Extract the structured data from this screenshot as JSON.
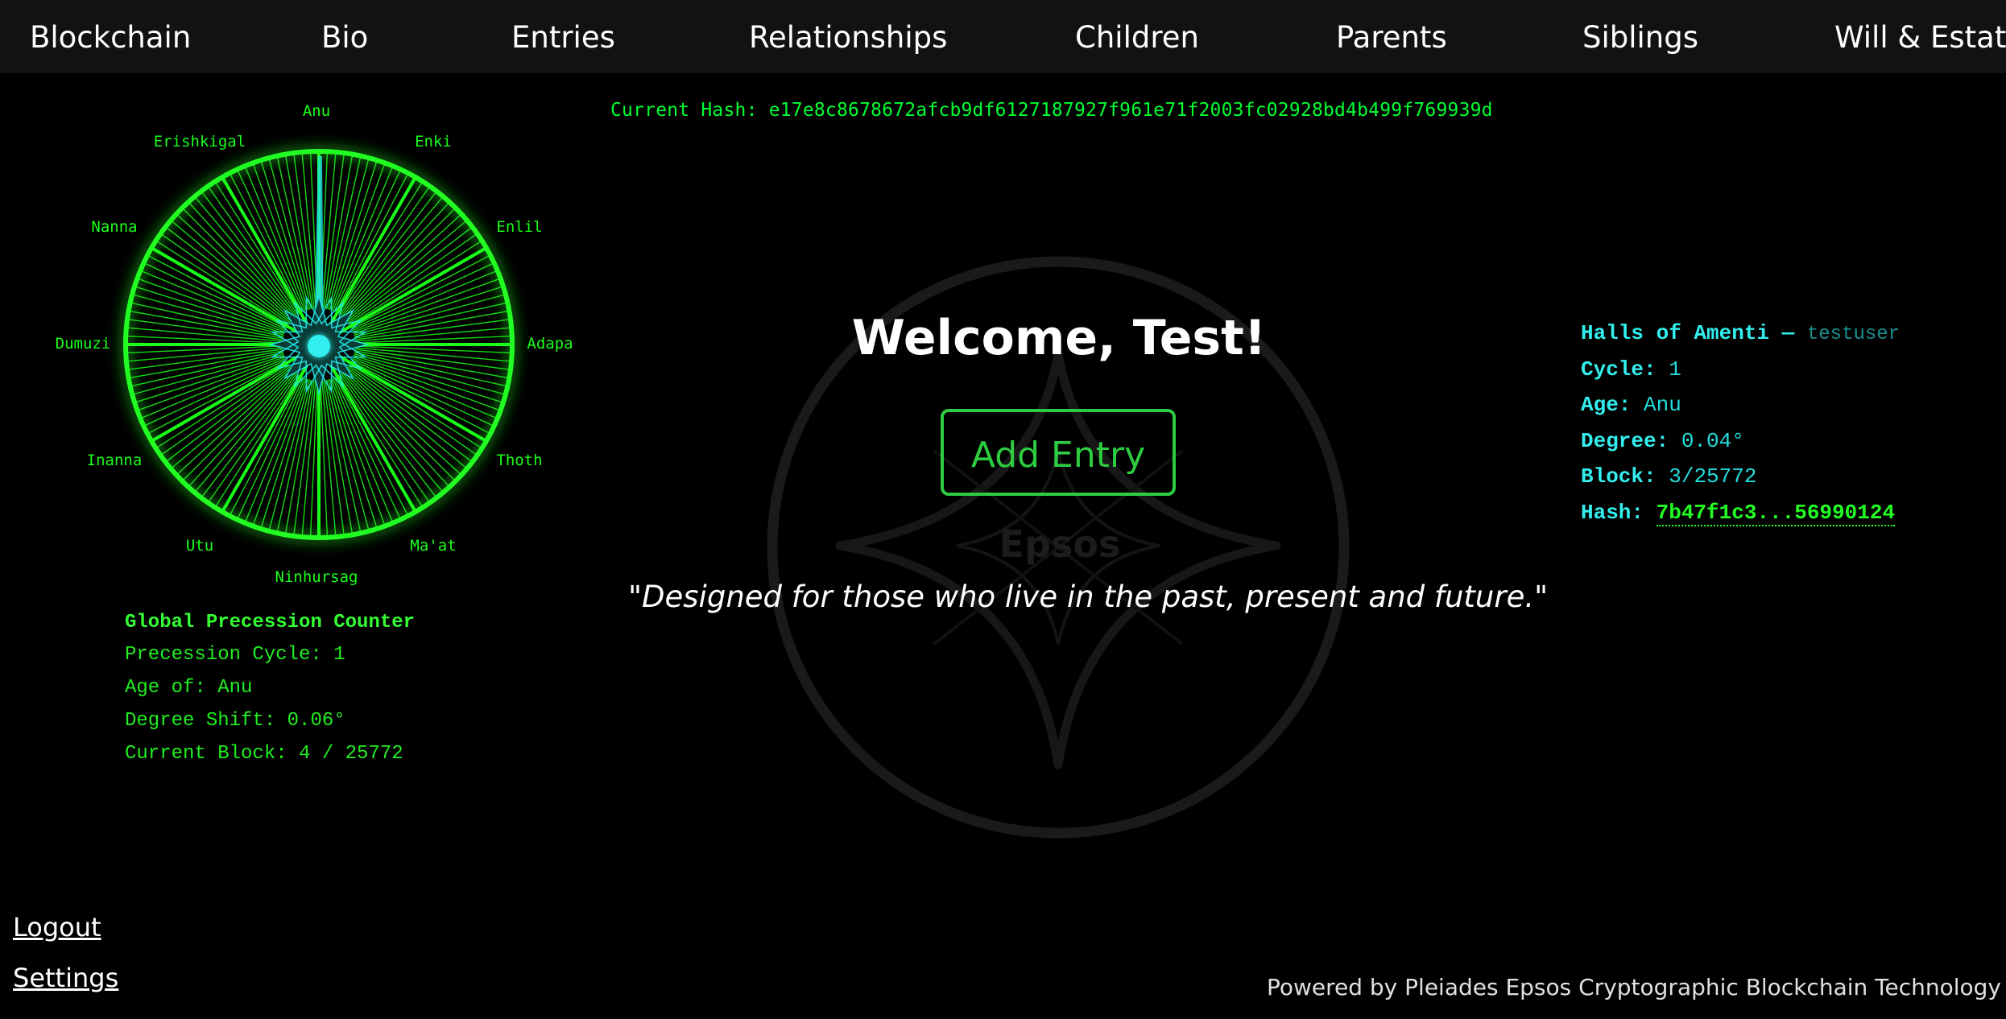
{
  "nav": {
    "items": [
      "Blockchain",
      "Bio",
      "Entries",
      "Relationships",
      "Children",
      "Parents",
      "Siblings",
      "Will & Estate"
    ]
  },
  "hash_bar": {
    "label": "Current Hash:",
    "value": "e17e8c8678672afcb9df6127187927f961e71f2003fc02928bd4b499f769939d"
  },
  "wheel": {
    "labels": [
      "Anu",
      "Enki",
      "Enlil",
      "Adapa",
      "Thoth",
      "Ma'at",
      "Ninhursag",
      "Utu",
      "Inanna",
      "Dumuzi",
      "Nanna",
      "Erishkigal"
    ],
    "colors": {
      "green": "#19ff19",
      "cyan": "#22e5e5"
    }
  },
  "counter": {
    "title": "Global Precession Counter",
    "cycle": "Precession Cycle: 1",
    "age": "Age of: Anu",
    "degree": "Degree Shift: 0.06°",
    "block": "Current Block: 4 / 25772"
  },
  "main": {
    "welcome": "Welcome, Test!",
    "add_entry_label": "Add Entry",
    "quote": "\"Designed for those who live in the past, present and future.\"",
    "watermark": "Epsos"
  },
  "halls": {
    "title": "Halls of Amenti —",
    "user": "testuser",
    "cycle_label": "Cycle:",
    "cycle_value": "1",
    "age_label": "Age:",
    "age_value": "Anu",
    "degree_label": "Degree:",
    "degree_value": "0.04°",
    "block_label": "Block:",
    "block_value": "3/25772",
    "hash_label": "Hash:",
    "hash_value": "7b47f1c3...56990124"
  },
  "footer": {
    "logout": "Logout",
    "settings": "Settings",
    "powered": "Powered by Pleiades Epsos Cryptographic Blockchain Technology"
  },
  "colors": {
    "nav_bg": "#121212",
    "accent_green": "#2ecc40",
    "terminal_green": "#00ff33",
    "cyan": "#22dddd"
  }
}
